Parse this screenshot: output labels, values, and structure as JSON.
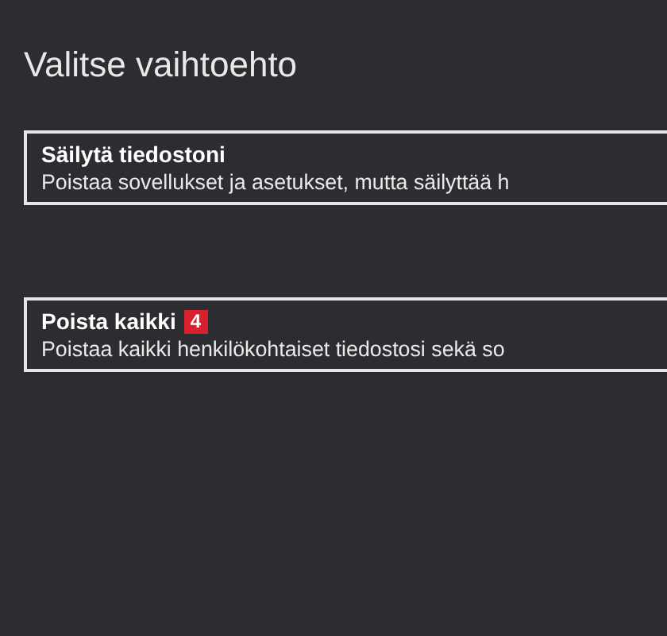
{
  "title": "Valitse vaihtoehto",
  "options": [
    {
      "title": "Säilytä tiedostoni",
      "description": "Poistaa sovellukset ja asetukset, mutta säilyttää h"
    },
    {
      "title": "Poista kaikki",
      "badge": "4",
      "description": "Poistaa kaikki henkilökohtaiset tiedostosi sekä so"
    }
  ]
}
